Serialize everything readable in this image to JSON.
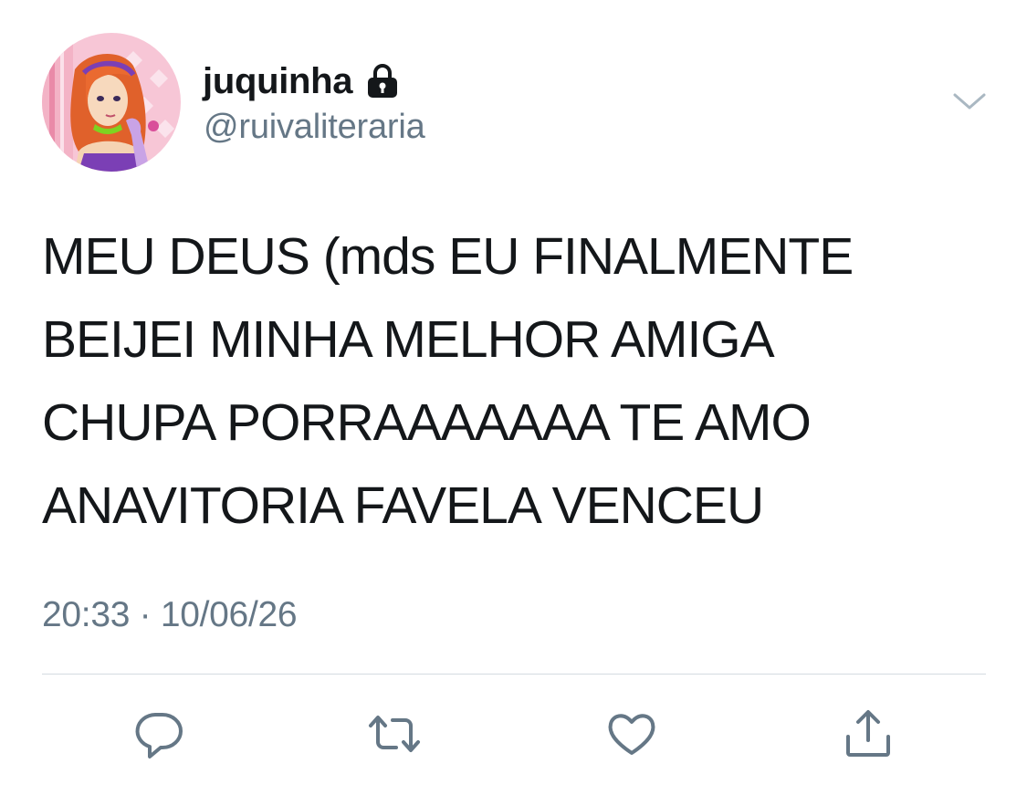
{
  "tweet": {
    "author": {
      "display_name": "juquinha",
      "handle": "@ruivaliteraria",
      "avatar": "cartoon-redhead-avatar",
      "protected_icon": "lock-icon"
    },
    "menu_icon": "chevron-down-icon",
    "text_lines": [
      "MEU DEUS (mds EU FINALMENTE",
      "BEIJEI MINHA MELHOR AMIGA",
      "CHUPA PORRAAAAAAA TE AMO",
      "ANAVITORIA FAVELA VENCEU"
    ],
    "timestamp": "20:33 · 10/06/26"
  },
  "actions": [
    {
      "name": "reply",
      "icon": "reply-icon"
    },
    {
      "name": "retweet",
      "icon": "retweet-icon"
    },
    {
      "name": "like",
      "icon": "heart-icon"
    },
    {
      "name": "share",
      "icon": "share-icon"
    }
  ],
  "colors": {
    "text": "#14171a",
    "secondary": "#657786",
    "divider": "#d4dbe0",
    "icon": "#657786"
  }
}
